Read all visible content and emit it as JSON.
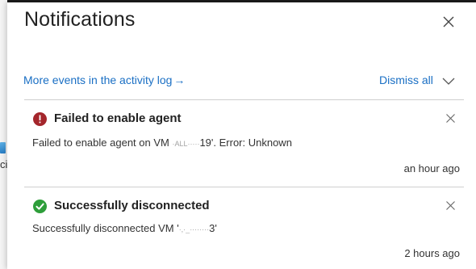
{
  "panel": {
    "title": "Notifications"
  },
  "links": {
    "activity_log": "More events in the activity log",
    "activity_log_arrow": "→",
    "dismiss_all": "Dismiss all"
  },
  "notifications": [
    {
      "status": "error",
      "icon": "error-icon",
      "color": "#a4262c",
      "title": "Failed to enable agent",
      "body_prefix": "Failed to enable agent on VM ",
      "body_redacted": "·ALL·····",
      "body_suffix": "19'. Error: Unknown",
      "time": "an hour ago"
    },
    {
      "status": "success",
      "icon": "success-icon",
      "color": "#2e9e3a",
      "title": "Successfully disconnected",
      "body_prefix": "Successfully disconnected VM '",
      "body_redacted": "·,·_········",
      "body_suffix": "3'",
      "time": "2 hours ago"
    }
  ],
  "background": {
    "left_fragment": "ci"
  }
}
